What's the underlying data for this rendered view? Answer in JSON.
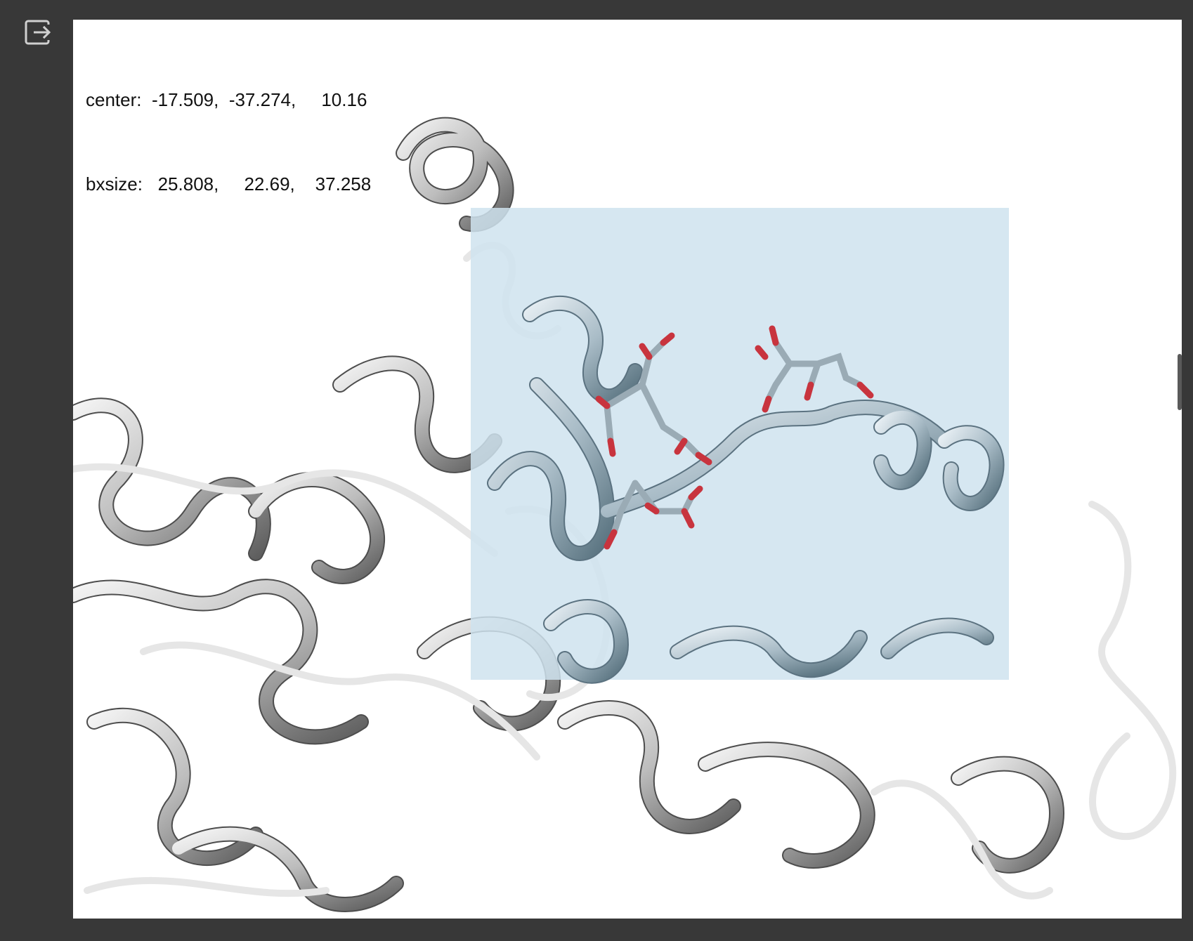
{
  "toolbar": {
    "output_icon": "exit-to-app-icon"
  },
  "viewer": {
    "center_label": "center:",
    "center_x": "-17.509,",
    "center_y": "-37.274,",
    "center_z": "10.16",
    "size_label": "bxsize:",
    "size_x": "25.808,",
    "size_y": "22.69,",
    "size_z": "37.258"
  },
  "colors": {
    "background": "#383838",
    "canvas": "#ffffff",
    "grid_box": "#cfe3ef",
    "protein_ribbon": "#bfbfbf",
    "ligand_carbon": "#9aabb5",
    "ligand_oxygen": "#c8343e"
  }
}
